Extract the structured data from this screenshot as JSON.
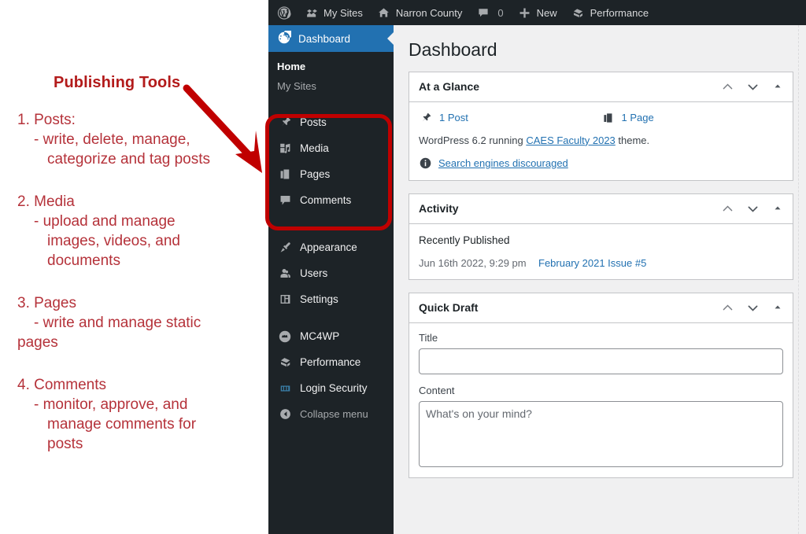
{
  "annotation": {
    "title": "Publishing Tools",
    "items": [
      {
        "number": "1. Posts:",
        "lines": [
          "- write, delete, manage,",
          "categorize and tag posts"
        ]
      },
      {
        "number": "2. Media",
        "lines": [
          "- upload and manage",
          "images, videos, and",
          "documents"
        ]
      },
      {
        "number": "3. Pages",
        "lines": [
          "- write and manage static",
          "pages"
        ]
      },
      {
        "number": "4. Comments",
        "lines": [
          "- monitor, approve, and",
          "manage comments for",
          "posts"
        ]
      }
    ],
    "accent_color": "#b5323a",
    "title_color": "#b31b1b",
    "highlight_color": "#c00000"
  },
  "admin_bar": {
    "wp_logo": "wordpress-logo-icon",
    "items": [
      {
        "icon": "my-sites-icon",
        "label": "My Sites"
      },
      {
        "icon": "home-icon",
        "label": "Narron County"
      },
      {
        "icon": "comment-icon",
        "label": "",
        "count": "0"
      },
      {
        "icon": "plus-icon",
        "label": "New"
      },
      {
        "icon": "performance-icon",
        "label": "Performance"
      }
    ]
  },
  "sidebar": {
    "active": "Dashboard",
    "dashboard": {
      "label": "Dashboard",
      "icon": "dashboard-icon"
    },
    "submenu": [
      {
        "label": "Home",
        "current": true
      },
      {
        "label": "My Sites",
        "current": false
      }
    ],
    "highlighted_group": [
      {
        "label": "Posts",
        "icon": "pushpin-icon"
      },
      {
        "label": "Media",
        "icon": "media-icon"
      },
      {
        "label": "Pages",
        "icon": "pages-icon"
      },
      {
        "label": "Comments",
        "icon": "comment-bubble-icon"
      }
    ],
    "group_two": [
      {
        "label": "Appearance",
        "icon": "paintbrush-icon"
      },
      {
        "label": "Users",
        "icon": "users-icon"
      },
      {
        "label": "Settings",
        "icon": "settings-icon"
      }
    ],
    "group_three": [
      {
        "label": "MC4WP",
        "icon": "mailchimp-icon"
      },
      {
        "label": "Performance",
        "icon": "performance-icon"
      },
      {
        "label": "Login Security",
        "icon": "login-security-icon"
      }
    ],
    "collapse": {
      "label": "Collapse menu",
      "icon": "collapse-arrow-icon"
    },
    "background_color": "#1d2327",
    "active_color": "#2271b1"
  },
  "page": {
    "title": "Dashboard"
  },
  "at_a_glance": {
    "title": "At a Glance",
    "post_count": "1 Post",
    "page_count": "1 Page",
    "version_prefix": "WordPress 6.2 running ",
    "theme_link": "CAES Faculty 2023",
    "version_suffix": " theme.",
    "search_engines": "Search engines discouraged"
  },
  "activity": {
    "title": "Activity",
    "subtitle": "Recently Published",
    "published_date": "Jun 16th 2022, 9:29 pm",
    "published_title": "February 2021 Issue #5"
  },
  "quick_draft": {
    "title": "Quick Draft",
    "title_label": "Title",
    "title_value": "",
    "title_placeholder": "",
    "content_label": "Content",
    "content_value": "",
    "content_placeholder": "What's on your mind?"
  },
  "panel_controls": {
    "move_up": "order-higher-icon",
    "move_down": "order-lower-icon",
    "toggle": "toggle-indicator-icon"
  }
}
